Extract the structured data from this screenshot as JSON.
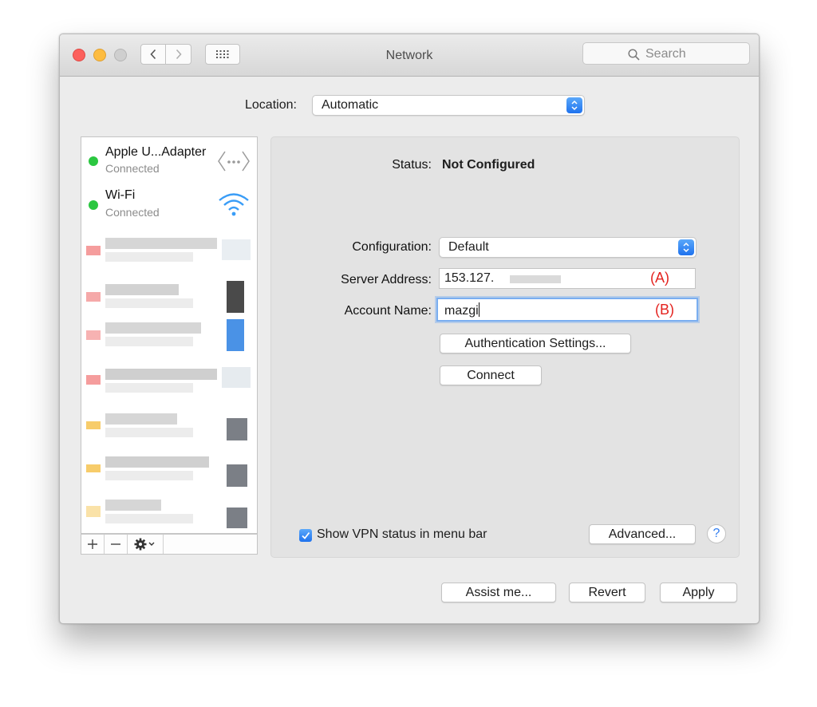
{
  "window": {
    "title": "Network"
  },
  "toolbar": {
    "search_placeholder": "Search"
  },
  "location": {
    "label": "Location:",
    "value": "Automatic"
  },
  "services": [
    {
      "name": "Apple U...Adapter",
      "status": "Connected",
      "icon": "ethernet-icon",
      "status_color": "#2bc740"
    },
    {
      "name": "Wi-Fi",
      "status": "Connected",
      "icon": "wifi-icon",
      "status_color": "#2bc740"
    }
  ],
  "sidebar_tools": {
    "add": "+",
    "remove": "−",
    "action": "gear-icon"
  },
  "detail": {
    "status_label": "Status:",
    "status_value": "Not Configured",
    "configuration_label": "Configuration:",
    "configuration_value": "Default",
    "server_label": "Server Address:",
    "server_value": "153.127.",
    "server_annotation": "(A)",
    "account_label": "Account Name:",
    "account_value": "mazgi",
    "account_annotation": "(B)",
    "auth_button": "Authentication Settings...",
    "connect_button": "Connect",
    "show_vpn_label": "Show VPN status in menu bar",
    "show_vpn_checked": true,
    "advanced_button": "Advanced...",
    "help": "?"
  },
  "footer": {
    "assist": "Assist me...",
    "revert": "Revert",
    "apply": "Apply"
  },
  "colors": {
    "accent": "#1e72ee",
    "annotation": "#e4231f",
    "connected": "#2bc740"
  }
}
